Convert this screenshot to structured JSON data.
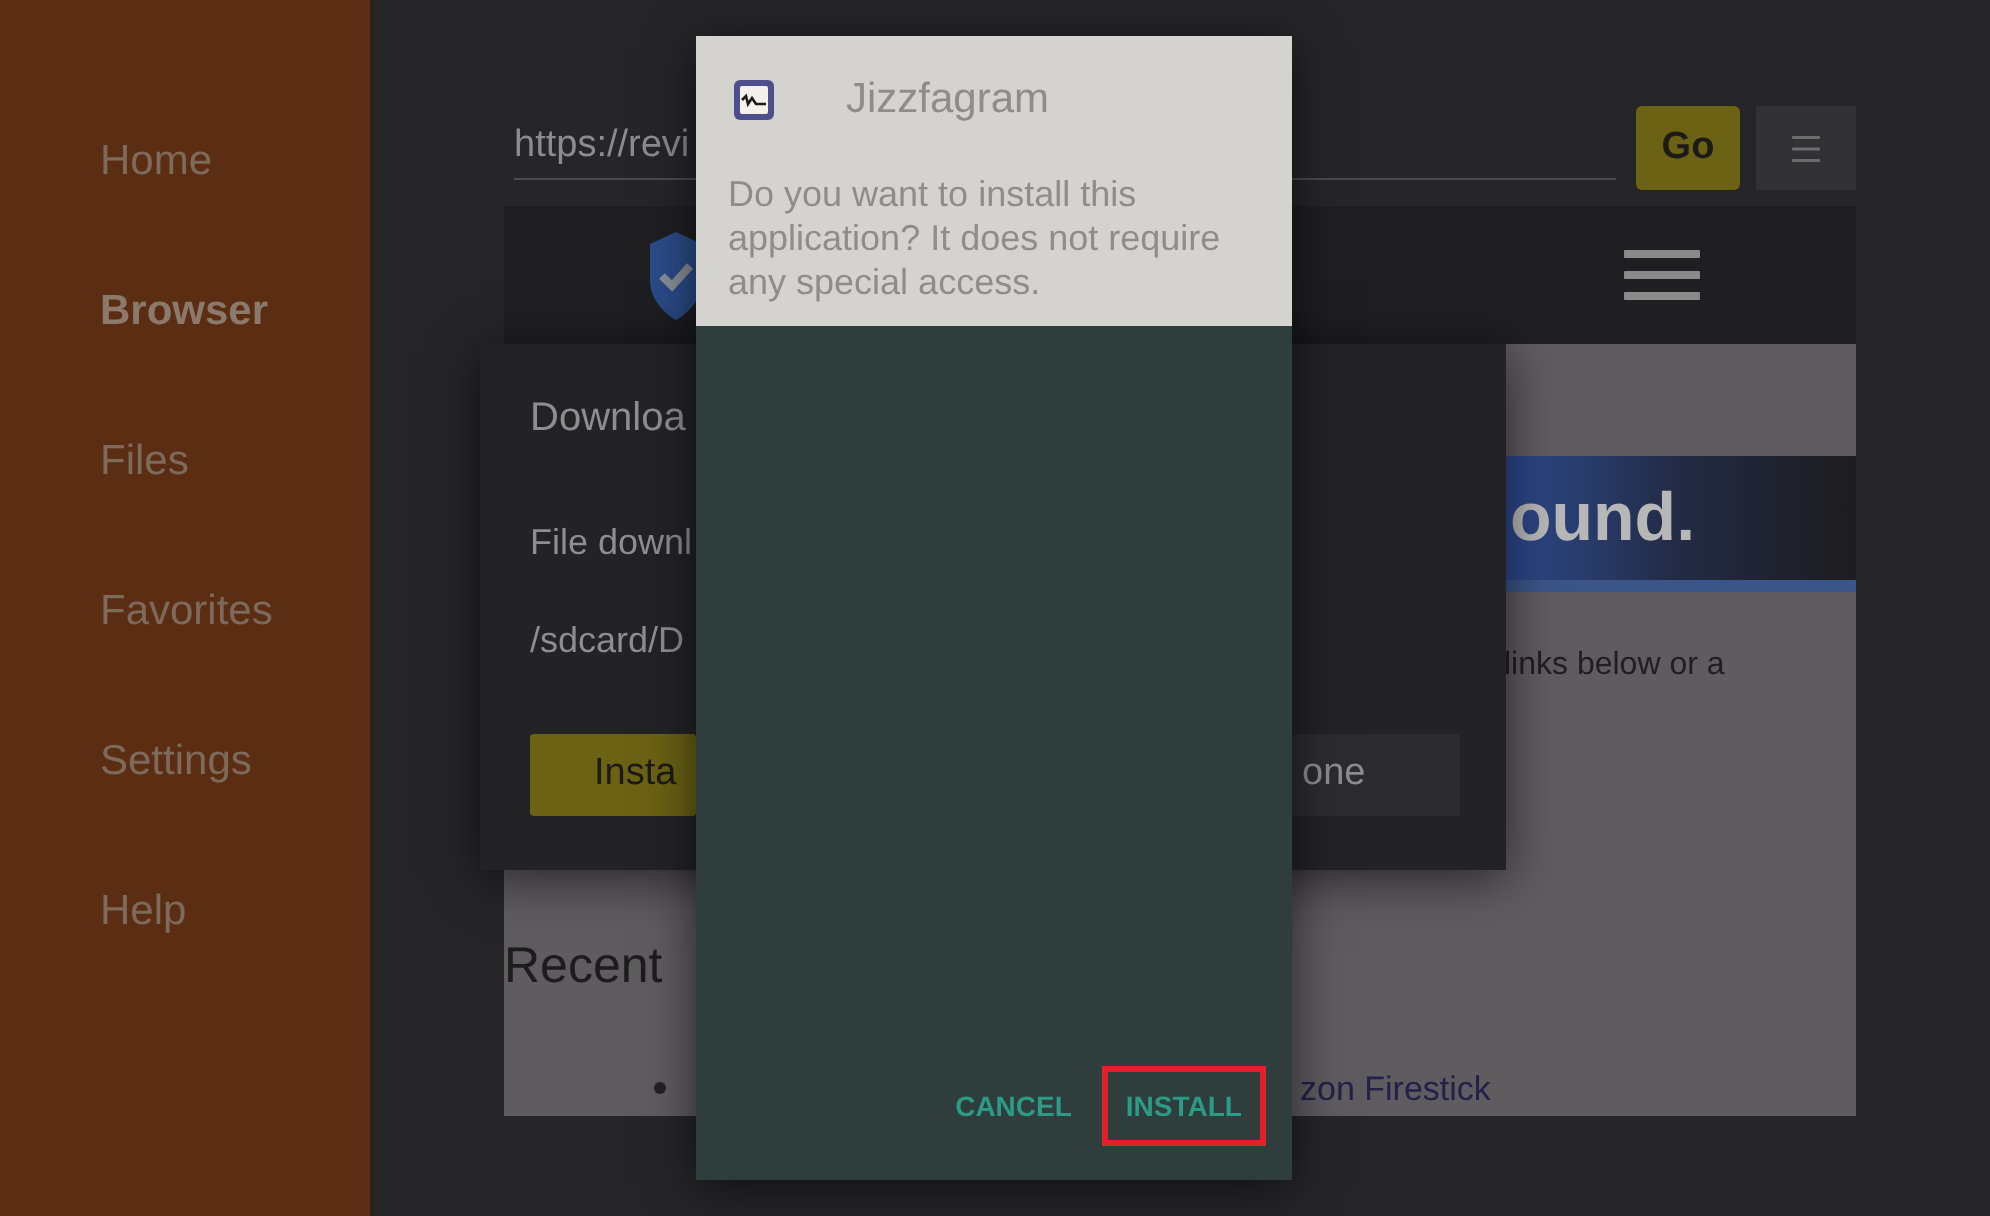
{
  "sidebar": {
    "items": [
      {
        "label": "Home",
        "selected": false
      },
      {
        "label": "Browser",
        "selected": true
      },
      {
        "label": "Files",
        "selected": false
      },
      {
        "label": "Favorites",
        "selected": false
      },
      {
        "label": "Settings",
        "selected": false
      },
      {
        "label": "Help",
        "selected": false
      }
    ]
  },
  "browser": {
    "address_bar": {
      "value": "https://revi"
    },
    "go_button": {
      "label": "Go"
    },
    "page": {
      "banner_text": "ound.",
      "body_text": "links below or a",
      "heading": "Recent",
      "list_items": [
        {
          "text": "zon Firestick"
        }
      ]
    }
  },
  "download_dialog": {
    "title": "Downloa",
    "lines": [
      "File downl",
      "/sdcard/D"
    ],
    "buttons": [
      {
        "label": "Insta",
        "kind": "primary"
      },
      {
        "label": "one",
        "kind": "secondary"
      }
    ]
  },
  "install_dialog": {
    "app_name": "Jizzfagram",
    "message": "Do you want to install this application? It does not require any special access.",
    "buttons": [
      {
        "label": "CANCEL",
        "highlighted": false
      },
      {
        "label": "INSTALL",
        "highlighted": true
      }
    ]
  }
}
